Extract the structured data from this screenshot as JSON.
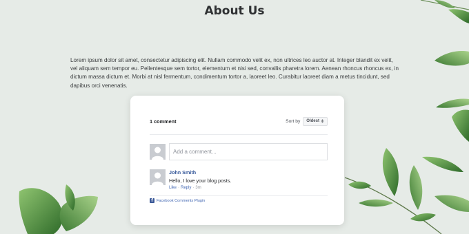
{
  "page": {
    "title": "About Us",
    "paragraph": "Lorem ipsum dolor sit amet, consectetur adipiscing elit. Nullam commodo velit ex, non ultrices leo auctor at. Integer blandit ex velit, vel aliquam sem tempor eu. Pellentesque sem tortor, elementum et nisi sed, convallis pharetra lorem. Aenean rhoncus rhoncus ex, in dictum massa dictum et. Morbi at nisl fermentum, condimentum tortor a, laoreet leo. Curabitur laoreet diam a metus tincidunt, sed dapibus orci venenatis."
  },
  "comments": {
    "count_label": "1 comment",
    "sort_label": "Sort by",
    "sort_selected": "Oldest",
    "sort_caret": "⇕",
    "add_placeholder": "Add a comment...",
    "items": [
      {
        "author": "John Smith",
        "text": "Hello, I love your blog posts.",
        "like_label": "Like",
        "reply_label": "Reply",
        "separator": "·",
        "time": "3m"
      }
    ],
    "plugin_label": "Facebook Comments Plugin",
    "plugin_icon": "f"
  },
  "colors": {
    "background": "#e6ebe7",
    "link": "#4267b2",
    "author": "#365899",
    "leaf": "#4f8a3c"
  }
}
